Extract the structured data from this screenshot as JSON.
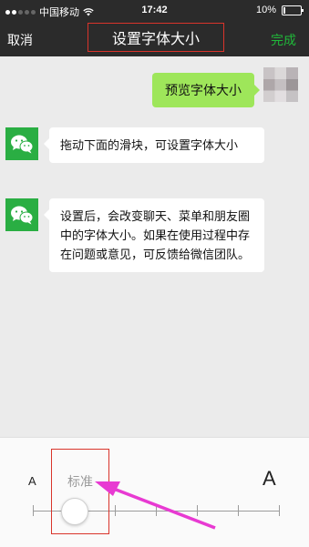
{
  "status_bar": {
    "carrier": "中国移动",
    "time": "17:42",
    "battery": "10%",
    "battery_level": 0.1
  },
  "nav": {
    "cancel_label": "取消",
    "title": "设置字体大小",
    "done_label": "完成"
  },
  "chat": {
    "sent_message": "预览字体大小",
    "received_messages": [
      "拖动下面的滑块，可设置字体大小",
      "设置后，会改变聊天、菜单和朋友圈中的字体大小。如果在使用过程中存在问题或意见，可反馈给微信团队。"
    ]
  },
  "font_slider": {
    "small_label": "A",
    "large_label": "A",
    "current_label": "标准",
    "current_step": 1,
    "steps": 7
  },
  "colors": {
    "nav_background": "#2b2b2b",
    "done_text": "#20b83a",
    "sent_bubble": "#9ee65a",
    "wechat_avatar": "#2aae43",
    "annotation": "#d9342b",
    "arrow": "#e83ad2"
  }
}
